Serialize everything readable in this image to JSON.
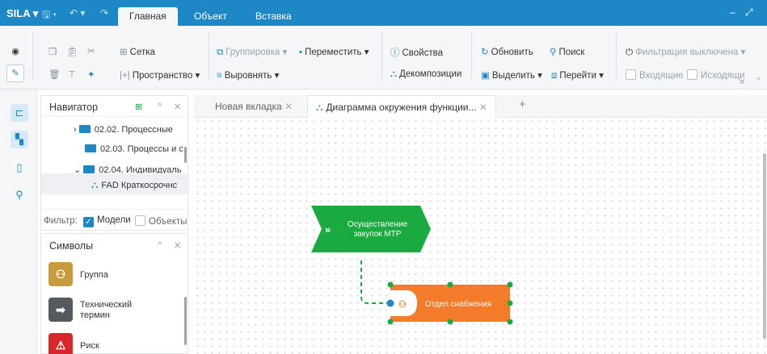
{
  "app": {
    "brand": "SILA"
  },
  "ribbon_tabs": [
    "Главная",
    "Объект",
    "Вставка"
  ],
  "ribbon": {
    "grid": "Сетка",
    "space": "Пространство",
    "group": "Группировка",
    "move": "Переместить",
    "align": "Выровнять",
    "properties": "Свойства",
    "decompositions": "Декомпозиции",
    "refresh": "Обновить",
    "search": "Поиск",
    "select": "Выделить",
    "goto": "Перейти",
    "filter": "Фильтрация выключена",
    "incoming": "Входящие",
    "outgoing": "Исходящи"
  },
  "navigator": {
    "title": "Навигатор",
    "items": [
      {
        "label": "02.02. Процессные"
      },
      {
        "label": "02.03. Процессы и с"
      },
      {
        "label": "02.04. Индивидуаль"
      },
      {
        "label": "FAD Краткосрочнс"
      }
    ],
    "filter_label": "Фильтр:",
    "filter_models": "Модели",
    "filter_objects": "Объекты"
  },
  "symbols": {
    "title": "Символы",
    "items": [
      {
        "label": "Группа",
        "color": "#c89b3c"
      },
      {
        "label": "Технический",
        "label2": "термин",
        "color": "#555a5f"
      },
      {
        "label": "Риск",
        "color": "#d9262b"
      }
    ]
  },
  "doc_tabs": {
    "tab1": "Новая вкладка",
    "tab2": "Диаграмма окружения функции..."
  },
  "diagram": {
    "function_line1": "Осуществление",
    "function_line2": "закупок МТР",
    "org_unit": "Отдел снабжения",
    "function_color": "#1aaa3f",
    "org_color": "#f47b2a"
  }
}
